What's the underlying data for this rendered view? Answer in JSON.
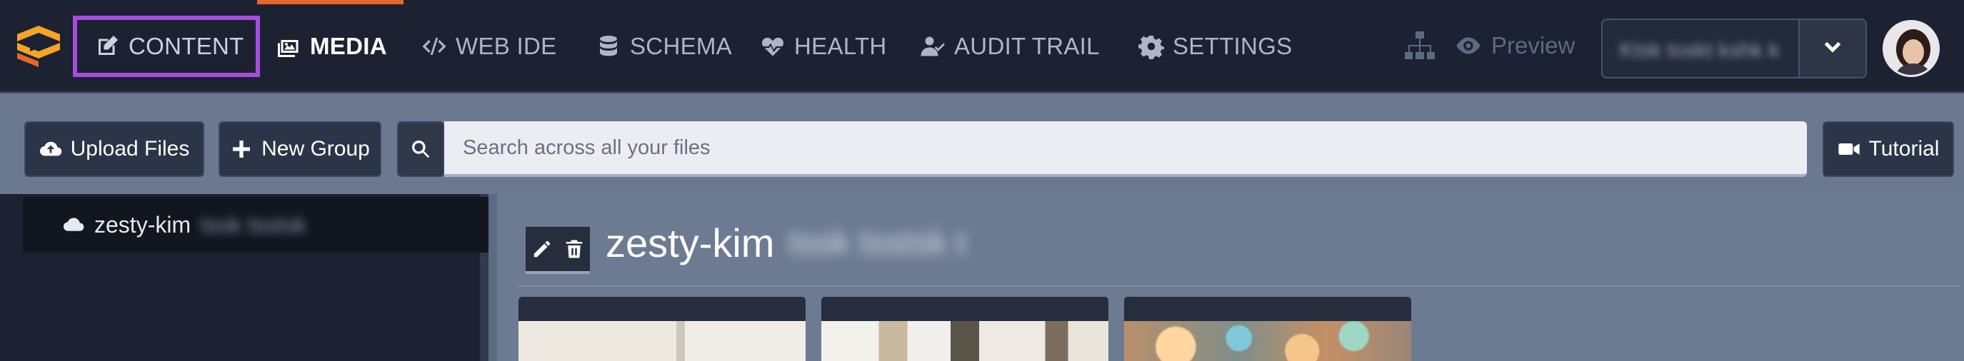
{
  "nav": {
    "items": [
      {
        "label": "CONTENT",
        "icon": "edit-icon"
      },
      {
        "label": "MEDIA",
        "icon": "image-icon"
      },
      {
        "label": "WEB IDE",
        "icon": "code-icon"
      },
      {
        "label": "SCHEMA",
        "icon": "database-icon"
      },
      {
        "label": "HEALTH",
        "icon": "heartbeat-icon"
      },
      {
        "label": "AUDIT TRAIL",
        "icon": "user-check-icon"
      },
      {
        "label": "SETTINGS",
        "icon": "gear-icon"
      }
    ],
    "active": "MEDIA",
    "highlighted": "CONTENT",
    "preview_label": "Preview",
    "instance_name": "Ktsk toskt kshk k"
  },
  "toolbar": {
    "upload_label": "Upload Files",
    "new_group_label": "New Group",
    "search_placeholder": "Search across all your files",
    "tutorial_label": "Tutorial"
  },
  "sidebar": {
    "item_label": "zesty-kim",
    "item_blurred": "tssk tsstsk"
  },
  "main": {
    "group_title": "zesty-kim",
    "group_title_blurred": "tssk tsstsk t"
  },
  "colors": {
    "accent": "#e5692d",
    "highlight": "#a64cdf",
    "topbar_bg": "#1c2232"
  }
}
